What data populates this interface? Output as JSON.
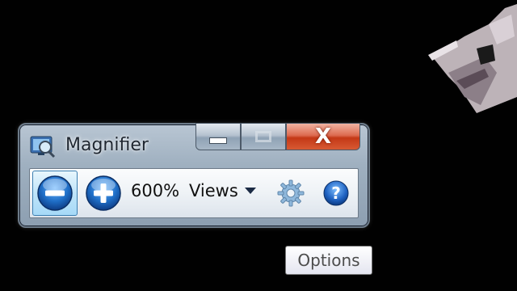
{
  "window": {
    "title": "Magnifier",
    "caption_buttons": {
      "minimize_icon": "minimize-icon",
      "maximize_icon": "maximize-icon",
      "close_label": "X"
    }
  },
  "toolbar": {
    "zoom_out_icon": "minus-icon",
    "zoom_in_icon": "plus-icon",
    "zoom_level": "600%",
    "views_label": "Views",
    "options_icon": "gear-icon",
    "help_icon": "help-icon"
  },
  "tooltip": {
    "text": "Options"
  },
  "colors": {
    "background": "#010101",
    "close_red": "#c43816",
    "button_blue": "#1f6ec6"
  }
}
